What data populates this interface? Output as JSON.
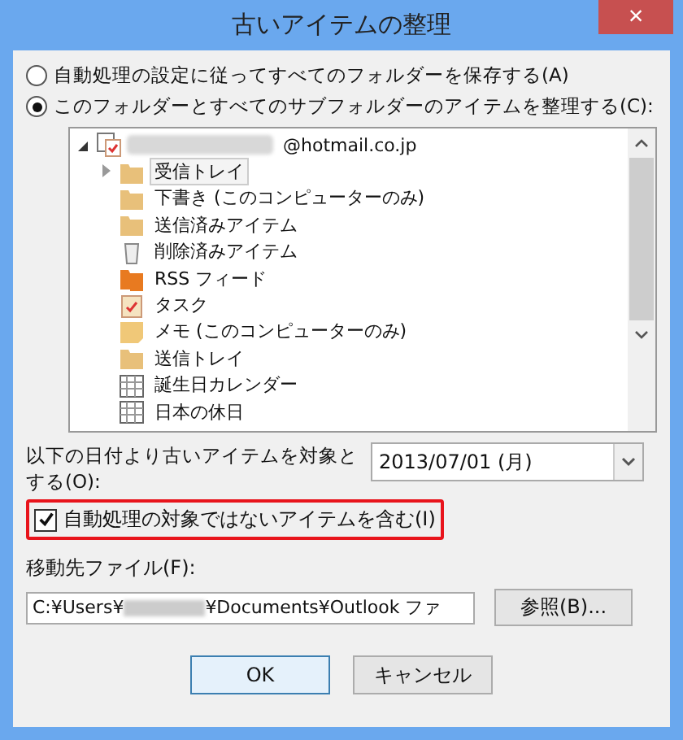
{
  "window": {
    "title": "古いアイテムの整理",
    "close": "×"
  },
  "options": [
    {
      "label": "自動処理の設定に従ってすべてのフォルダーを保存する(A)",
      "selected": false
    },
    {
      "label": "このフォルダーとすべてのサブフォルダーのアイテムを整理する(C):",
      "selected": true
    }
  ],
  "tree": {
    "account": {
      "name_redacted": true,
      "suffix": "@hotmail.co.jp",
      "expanded": true,
      "children": [
        {
          "label": "受信トレイ",
          "kind": "inbox",
          "selected": true,
          "expanded": false
        },
        {
          "label": "下書き (このコンピューターのみ)",
          "kind": "drafts",
          "selected": false
        },
        {
          "label": "送信済みアイテム",
          "kind": "sent",
          "selected": false
        },
        {
          "label": "削除済みアイテム",
          "kind": "trash",
          "selected": false
        },
        {
          "label": "RSS フィード",
          "kind": "rss",
          "selected": false
        },
        {
          "label": "タスク",
          "kind": "tasks",
          "selected": false
        },
        {
          "label": "メモ (このコンピューターのみ)",
          "kind": "notes",
          "selected": false
        },
        {
          "label": "送信トレイ",
          "kind": "outbox",
          "selected": false
        },
        {
          "label": "誕生日カレンダー",
          "kind": "calendar",
          "selected": false
        },
        {
          "label": "日本の休日",
          "kind": "calendar",
          "selected": false
        }
      ]
    }
  },
  "date": {
    "label": "以下の日付より古いアイテムを対象とする(O):",
    "value": "2013/07/01 (月)"
  },
  "include_checkbox": {
    "label": "自動処理の対象ではないアイテムを含む(I)",
    "checked": true,
    "highlighted": true
  },
  "move_file": {
    "label": "移動先ファイル(F):",
    "value_start": "C:¥Users¥",
    "value_end": "¥Documents¥Outlook ファ",
    "browse": "参照(B)..."
  },
  "buttons": [
    {
      "label": "OK",
      "default": true
    },
    {
      "label": "キャンセル",
      "default": false
    }
  ]
}
